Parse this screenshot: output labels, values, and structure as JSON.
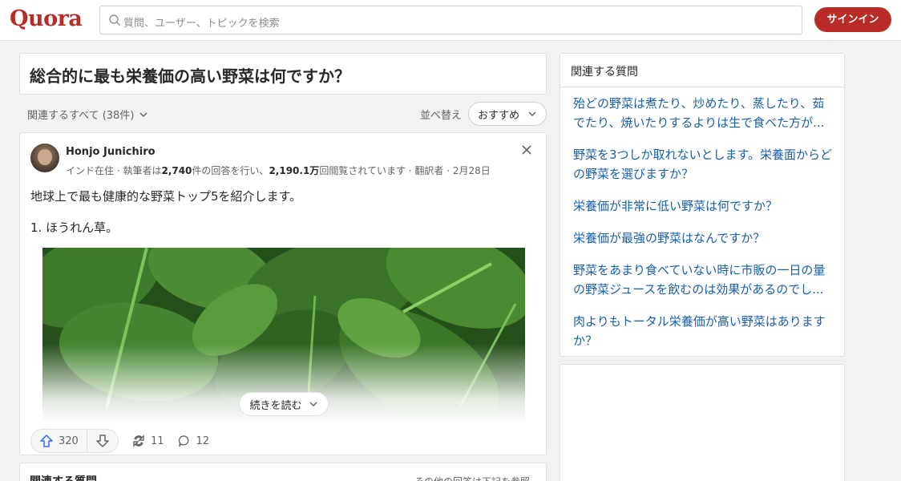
{
  "header": {
    "logo": "Quora",
    "search_placeholder": "質問、ユーザー、トピックを検索",
    "signin_label": "サインイン"
  },
  "question": {
    "title": "総合的に最も栄養価の高い野菜は何ですか？"
  },
  "filter": {
    "related_all": "関連するすべて (38件)",
    "sort_label": "並べ替え",
    "sort_value": "おすすめ"
  },
  "answer": {
    "author": "Honjo Junichiro",
    "meta_prefix": "インド在住 · 執筆者は",
    "answers_count": "2,740",
    "meta_mid": "件の回答を行い、",
    "views": "2,190.1万",
    "meta_suffix": "回閲覧されています · 翻訳者 · 2月28日",
    "paragraph1": "地球上で最も健康的な野菜トップ5を紹介します。",
    "paragraph2": "1. ほうれん草。",
    "read_more": "続きを読む",
    "upvotes": "320",
    "shares": "11",
    "comments": "12"
  },
  "bottom_card": {
    "left": "関連する質問",
    "right": "その他の回答は下記を参照"
  },
  "sidebar": {
    "title": "関連する質問",
    "items": [
      {
        "label": "殆どの野菜は煮たり、炒めたり、蒸したり、茹でたり、焼いたりするよりは生で食べた方が..."
      },
      {
        "label": "野菜を3つしか取れないとします。栄養面からどの野菜を選びますか？"
      },
      {
        "label": "栄養価が非常に低い野菜は何ですか？"
      },
      {
        "label": "栄養価が最強の野菜はなんですか？"
      },
      {
        "label": "野菜をあまり食べていない時に市販の一日の量の野菜ジュースを飲むのは効果があるのでし..."
      },
      {
        "label": "肉よりもトータル栄養価が高い野菜はありますか？"
      }
    ]
  },
  "colors": {
    "brand": "#b92b27",
    "link": "#195faa",
    "upvote": "#2e69ff"
  }
}
